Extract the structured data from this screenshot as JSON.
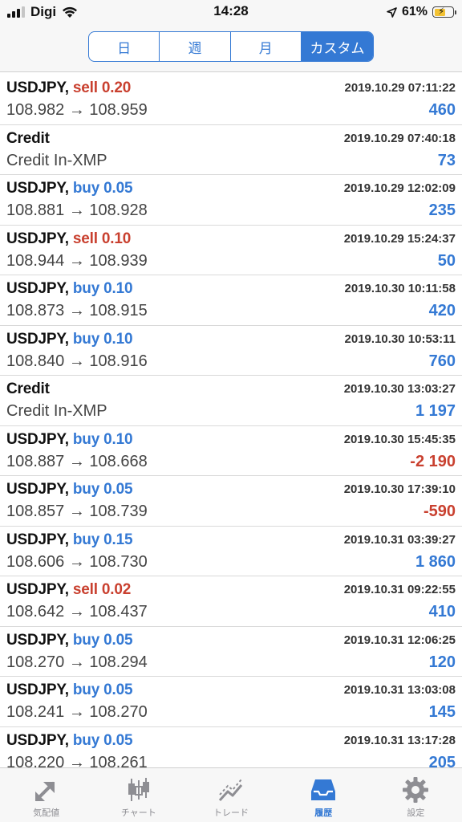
{
  "status_bar": {
    "carrier": "Digi",
    "time": "14:28",
    "battery_percent": "61%",
    "battery_level": 0.61,
    "battery_color": "#f3c233"
  },
  "segments": [
    {
      "label": "日",
      "active": false
    },
    {
      "label": "週",
      "active": false
    },
    {
      "label": "月",
      "active": false
    },
    {
      "label": "カスタム",
      "active": true
    }
  ],
  "colors": {
    "accent": "#3479d4",
    "sell": "#c9402f",
    "positive": "#3479d4",
    "negative": "#c9402f"
  },
  "rows": [
    {
      "symbol": "USDJPY,",
      "action": "sell 0.20",
      "type": "sell",
      "detail": "108.982 → 108.959",
      "date": "2019.10.29 07:11:22",
      "profit": "460",
      "sign": "pos"
    },
    {
      "symbol": "Credit",
      "action": "",
      "type": "",
      "detail": "Credit In-XMP",
      "date": "2019.10.29 07:40:18",
      "profit": "73",
      "sign": "pos"
    },
    {
      "symbol": "USDJPY,",
      "action": "buy 0.05",
      "type": "buy",
      "detail": "108.881 → 108.928",
      "date": "2019.10.29 12:02:09",
      "profit": "235",
      "sign": "pos"
    },
    {
      "symbol": "USDJPY,",
      "action": "sell 0.10",
      "type": "sell",
      "detail": "108.944 → 108.939",
      "date": "2019.10.29 15:24:37",
      "profit": "50",
      "sign": "pos"
    },
    {
      "symbol": "USDJPY,",
      "action": "buy 0.10",
      "type": "buy",
      "detail": "108.873 → 108.915",
      "date": "2019.10.30 10:11:58",
      "profit": "420",
      "sign": "pos"
    },
    {
      "symbol": "USDJPY,",
      "action": "buy 0.10",
      "type": "buy",
      "detail": "108.840 → 108.916",
      "date": "2019.10.30 10:53:11",
      "profit": "760",
      "sign": "pos"
    },
    {
      "symbol": "Credit",
      "action": "",
      "type": "",
      "detail": "Credit In-XMP",
      "date": "2019.10.30 13:03:27",
      "profit": "1 197",
      "sign": "pos"
    },
    {
      "symbol": "USDJPY,",
      "action": "buy 0.10",
      "type": "buy",
      "detail": "108.887 → 108.668",
      "date": "2019.10.30 15:45:35",
      "profit": "-2 190",
      "sign": "neg"
    },
    {
      "symbol": "USDJPY,",
      "action": "buy 0.05",
      "type": "buy",
      "detail": "108.857 → 108.739",
      "date": "2019.10.30 17:39:10",
      "profit": "-590",
      "sign": "neg"
    },
    {
      "symbol": "USDJPY,",
      "action": "buy 0.15",
      "type": "buy",
      "detail": "108.606 → 108.730",
      "date": "2019.10.31 03:39:27",
      "profit": "1 860",
      "sign": "pos"
    },
    {
      "symbol": "USDJPY,",
      "action": "sell 0.02",
      "type": "sell",
      "detail": "108.642 → 108.437",
      "date": "2019.10.31 09:22:55",
      "profit": "410",
      "sign": "pos"
    },
    {
      "symbol": "USDJPY,",
      "action": "buy 0.05",
      "type": "buy",
      "detail": "108.270 → 108.294",
      "date": "2019.10.31 12:06:25",
      "profit": "120",
      "sign": "pos"
    },
    {
      "symbol": "USDJPY,",
      "action": "buy 0.05",
      "type": "buy",
      "detail": "108.241 → 108.270",
      "date": "2019.10.31 13:03:08",
      "profit": "145",
      "sign": "pos"
    },
    {
      "symbol": "USDJPY,",
      "action": "buy 0.05",
      "type": "buy",
      "detail": "108.220 → 108.261",
      "date": "2019.10.31 13:17:28",
      "profit": "205",
      "sign": "pos"
    }
  ],
  "tabs": [
    {
      "label": "気配値",
      "icon": "quotes-arrows-icon",
      "active": false
    },
    {
      "label": "チャート",
      "icon": "candlestick-chart-icon",
      "active": false
    },
    {
      "label": "トレード",
      "icon": "trade-line-icon",
      "active": false
    },
    {
      "label": "履歴",
      "icon": "history-inbox-icon",
      "active": true
    },
    {
      "label": "設定",
      "icon": "settings-gear-icon",
      "active": false
    }
  ]
}
